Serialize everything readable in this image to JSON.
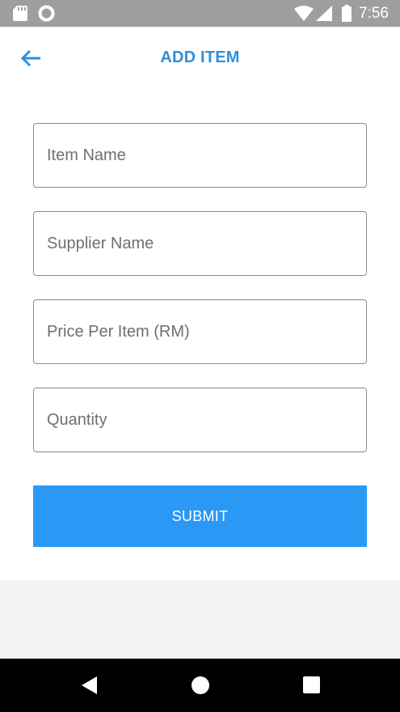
{
  "status_bar": {
    "time": "7:56",
    "icons": [
      "sd-card-icon",
      "circle-icon",
      "wifi-icon",
      "signal-icon",
      "battery-icon"
    ]
  },
  "header": {
    "title": "ADD ITEM",
    "back_icon": "arrow-left-icon",
    "accent_color": "#2f8fdc"
  },
  "form": {
    "fields": [
      {
        "placeholder": "Item Name",
        "value": ""
      },
      {
        "placeholder": "Supplier Name",
        "value": ""
      },
      {
        "placeholder": "Price Per Item (RM)",
        "value": ""
      },
      {
        "placeholder": "Quantity",
        "value": ""
      }
    ],
    "submit_label": "SUBMIT",
    "submit_color": "#2a99f5"
  },
  "nav_bar": {
    "icons": [
      "nav-back-icon",
      "nav-home-icon",
      "nav-recent-icon"
    ]
  }
}
